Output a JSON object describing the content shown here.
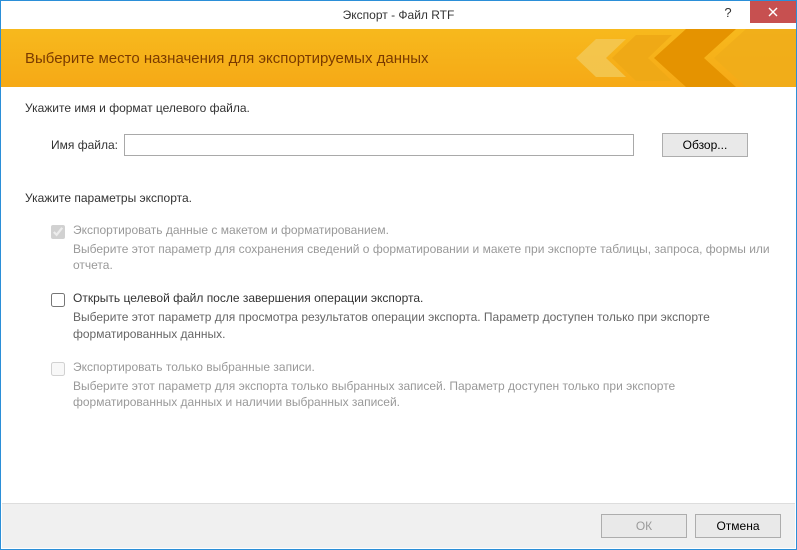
{
  "titlebar": {
    "title": "Экспорт - Файл RTF",
    "help": "?"
  },
  "banner": {
    "heading": "Выберите место назначения для экспортируемых данных"
  },
  "section1": {
    "label": "Укажите имя и формат целевого файла.",
    "filename_label": "Имя файла:",
    "filename_value": "",
    "browse": "Обзор..."
  },
  "section2": {
    "label": "Укажите параметры экспорта.",
    "options": [
      {
        "label": "Экспортировать данные с макетом и форматированием.",
        "desc": "Выберите этот параметр для сохранения сведений о форматировании и макете при экспорте таблицы, запроса, формы или отчета.",
        "checked": true,
        "disabled": true
      },
      {
        "label": "Открыть целевой файл после завершения операции экспорта.",
        "desc": "Выберите этот параметр для просмотра результатов операции экспорта. Параметр доступен только при экспорте форматированных данных.",
        "checked": false,
        "disabled": false
      },
      {
        "label": "Экспортировать только выбранные записи.",
        "desc": "Выберите этот параметр для экспорта только выбранных записей. Параметр доступен только при экспорте форматированных данных и наличии выбранных записей.",
        "checked": false,
        "disabled": true
      }
    ]
  },
  "footer": {
    "ok": "ОК",
    "cancel": "Отмена"
  }
}
